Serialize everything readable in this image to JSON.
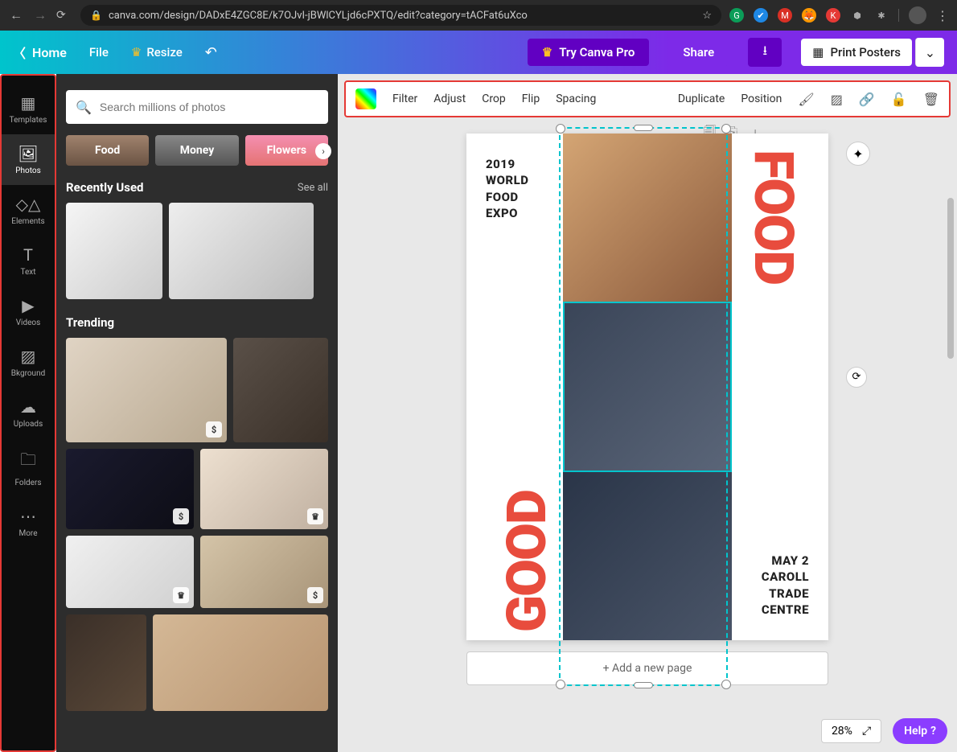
{
  "browser": {
    "url": "canva.com/design/DADxE4ZGC8E/k7OJvI-jBWlCYLjd6cPXTQ/edit?category=tACFat6uXco",
    "extensions": [
      "G",
      "✔",
      "M",
      "🦊",
      "K",
      "⬢",
      "✱"
    ]
  },
  "header": {
    "home": "Home",
    "file": "File",
    "resize": "Resize",
    "try_pro": "Try Canva Pro",
    "share": "Share",
    "print": "Print Posters"
  },
  "rail": {
    "templates": "Templates",
    "photos": "Photos",
    "elements": "Elements",
    "text": "Text",
    "videos": "Videos",
    "bkground": "Bkground",
    "uploads": "Uploads",
    "folders": "Folders",
    "more": "More"
  },
  "panel": {
    "search_placeholder": "Search millions of photos",
    "chips": {
      "food": "Food",
      "money": "Money",
      "flowers": "Flowers"
    },
    "recently_used": "Recently Used",
    "see_all": "See all",
    "trending": "Trending"
  },
  "context_toolbar": {
    "filter": "Filter",
    "adjust": "Adjust",
    "crop": "Crop",
    "flip": "Flip",
    "spacing": "Spacing",
    "duplicate": "Duplicate",
    "position": "Position"
  },
  "poster": {
    "good": "GOOD",
    "food": "FOOD",
    "expo_line1": "2019",
    "expo_line2": "WORLD",
    "expo_line3": "FOOD",
    "expo_line4": "EXPO",
    "venue_line1": "MAY 2",
    "venue_line2": "CAROLL",
    "venue_line3": "TRADE",
    "venue_line4": "CENTRE"
  },
  "canvas": {
    "add_page": "+ Add a new page",
    "zoom": "28%",
    "help": "Help"
  }
}
